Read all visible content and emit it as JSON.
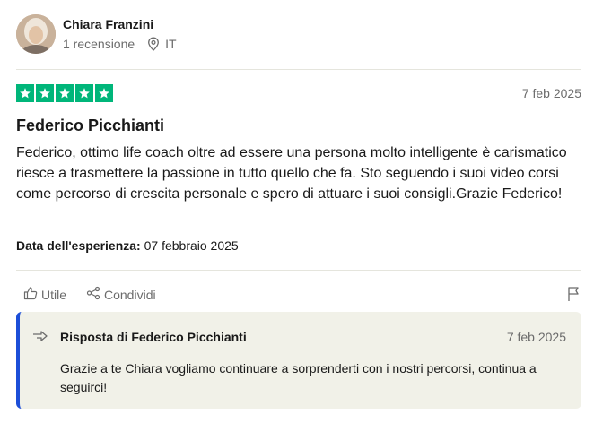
{
  "reviewer": {
    "name": "Chiara Franzini",
    "review_count": "1 recensione",
    "country": "IT"
  },
  "review": {
    "rating": 5,
    "rating_color": "#00b67a",
    "date": "7 feb 2025",
    "title": "Federico Picchianti",
    "body": "Federico, ottimo life coach oltre ad essere una persona molto intelligente è carismatico riesce a trasmettere la passione in tutto quello che fa. Sto seguendo i suoi video corsi come percorso di crescita personale e spero di attuare i suoi consigli.Grazie Federico!",
    "experience_label": "Data dell'esperienza:",
    "experience_date": "07 febbraio 2025"
  },
  "actions": {
    "useful_label": "Utile",
    "share_label": "Condividi",
    "useful_icon": "thumbs-up-icon",
    "share_icon": "share-icon",
    "report_icon": "flag-icon"
  },
  "reply": {
    "title": "Risposta di Federico Picchianti",
    "date": "7 feb 2025",
    "text": "Grazie a te Chiara vogliamo continuare a sorprenderti con i nostri percorsi, continua a seguirci!",
    "accent_color": "#1c4ed8",
    "icon": "reply-arrow-icon"
  }
}
